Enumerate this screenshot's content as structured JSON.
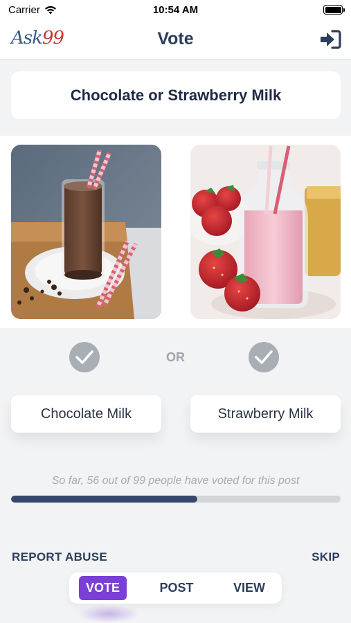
{
  "status_bar": {
    "carrier": "Carrier",
    "time": "10:54 AM"
  },
  "nav": {
    "logo_prefix": "Ask",
    "logo_suffix": "99",
    "title": "Vote"
  },
  "question": "Chocolate or Strawberry Milk",
  "or_label": "OR",
  "options": [
    {
      "label": "Chocolate Milk",
      "image": "chocolate-milk-photo"
    },
    {
      "label": "Strawberry Milk",
      "image": "strawberry-milk-photo"
    }
  ],
  "progress": {
    "text": "So far, 56 out of 99 people have voted for this post",
    "fraction": 0.5657
  },
  "actions": {
    "report": "REPORT ABUSE",
    "skip": "SKIP"
  },
  "tabs": [
    {
      "label": "VOTE",
      "active": true
    },
    {
      "label": "POST",
      "active": false
    },
    {
      "label": "VIEW",
      "active": false
    }
  ],
  "colors": {
    "accent": "#7a3fd6",
    "primary": "#2c3e5c",
    "progress": "#36486c"
  }
}
